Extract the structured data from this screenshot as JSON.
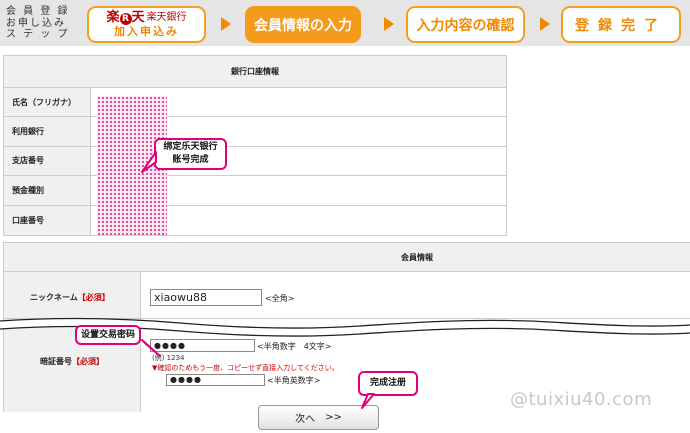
{
  "steps": {
    "intro": "会 員 登 録\nお申し込み\nス テ ッ プ",
    "step1_logo": "楽",
    "step1_logo_r": "R",
    "step1_logo_ten": "天",
    "step1_bank": "楽天銀行",
    "step1_sub": "加入申込み",
    "step2": "会員情報の入力",
    "step3": "入力内容の確認",
    "step4": "登録完了",
    "active_step": 2,
    "accent_color": "#f49a1d"
  },
  "bank_section": {
    "header": "銀行口座情報",
    "rows": [
      {
        "label": "氏名（フリガナ）"
      },
      {
        "label": "利用銀行"
      },
      {
        "label": "支店番号"
      },
      {
        "label": "預金種別"
      },
      {
        "label": "口座番号"
      }
    ]
  },
  "member_section": {
    "header": "会員情報",
    "nickname_label": "ニックネーム",
    "nickname_required": "【必須】",
    "nickname_value": "xiaowu88",
    "nickname_hint": "<全角>",
    "password_label": "暗証番号",
    "password_required": "【必須】",
    "password_value": "●●●●",
    "password_hint": "<半角数字　4文字>",
    "password_example": "(例) 1234",
    "password_warning": "▼確認のためもう一度、コピーせず直接入力してください。",
    "password_confirm_value": "●●●●",
    "password_confirm_hint": "<半角英数字>"
  },
  "next_button": {
    "label": "次へ",
    "arrows": ">>"
  },
  "callouts": {
    "bind_bank": "绑定乐天银行\n账号完成",
    "set_password": "设置交易密码",
    "complete": "完成注册"
  },
  "watermark": "@tuixiu40.com"
}
